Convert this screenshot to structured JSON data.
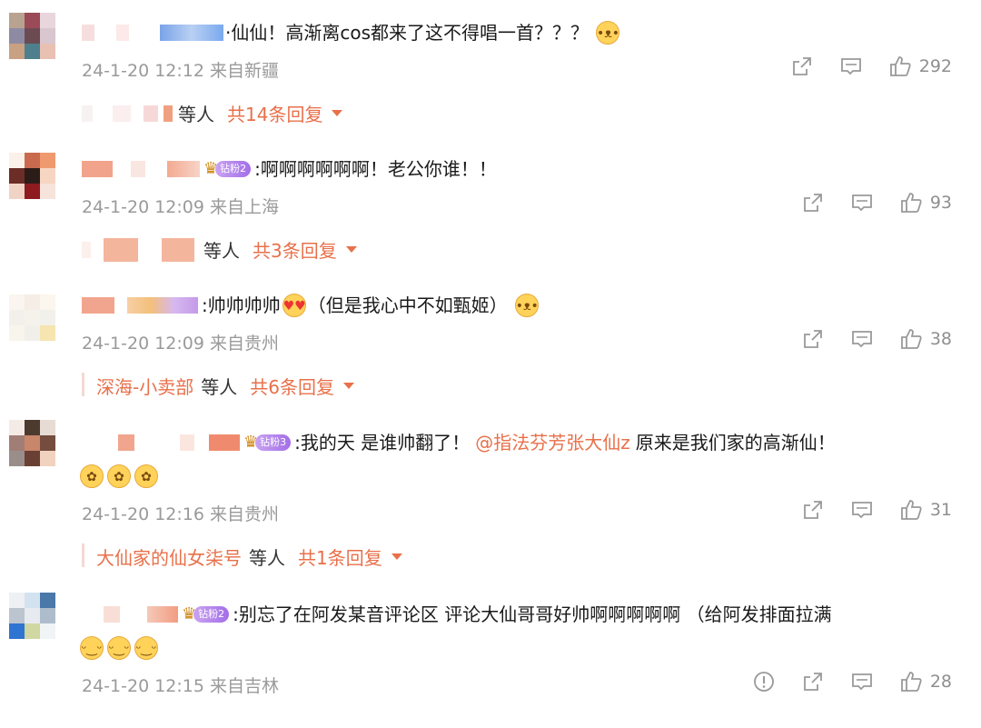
{
  "comments": [
    {
      "text": "·仙仙！高渐离cos都来了这不得唱一首？？？",
      "emoji_after": "dog-face-emoji",
      "time": "24-1-20 12:12",
      "location": "来自新疆",
      "likes": "292",
      "reply_names": "",
      "reply_deng": "等人",
      "reply_total": "共14条回复",
      "badge": null,
      "avatar_colors": [
        "#b8a390",
        "#9a4b57",
        "#e8d6dc",
        "#8f8aa4",
        "#6c4a51",
        "#d9c6cf",
        "#c8a082",
        "#4e7f8d",
        "#e8c1b2"
      ]
    },
    {
      "text": ":啊啊啊啊啊啊！老公你谁！！",
      "time": "24-1-20 12:09",
      "location": "来自上海",
      "likes": "93",
      "reply_names": "",
      "reply_deng": "等人",
      "reply_total": "共3条回复",
      "badge": {
        "fan_label": "钻粉2"
      },
      "avatar_colors": [
        "#fbf1e8",
        "#c96a4e",
        "#ee9a6e",
        "#6b2d25",
        "#2c1c17",
        "#f6d6c3",
        "#f1d3c6",
        "#8d1b1f",
        "#f6e3db"
      ]
    },
    {
      "text": ":帅帅帅帅",
      "text_after": "（但是我心中不如甄姬）",
      "emoji_mid": "heart-eyes-emoji",
      "emoji_after": "dog-face-emoji",
      "time": "24-1-20 12:09",
      "location": "来自贵州",
      "likes": "38",
      "reply_names": "深海-小卖部",
      "reply_deng": "等人",
      "reply_total": "共6条回复",
      "badge": null,
      "avatar_colors": [
        "#faf5ee",
        "#f6ede6",
        "#fbf6ee",
        "#f3f0ec",
        "#f4f2ea",
        "#f1f0ea",
        "#f8f5ec",
        "#f1efe9",
        "#f6e5b0"
      ]
    },
    {
      "text": ":我的天 是谁帅翻了！",
      "mention": "@指法芬芳张大仙z",
      "text_after": "原来是我们家的高渐仙！",
      "emoji_row": [
        "flower-face-emoji",
        "flower-face-emoji",
        "flower-face-emoji"
      ],
      "time": "24-1-20 12:16",
      "location": "来自贵州",
      "likes": "31",
      "reply_names": "大仙家的仙女柒号",
      "reply_deng": "等人",
      "reply_total": "共1条回复",
      "badge": {
        "fan_label": "钻粉3"
      },
      "avatar_colors": [
        "#f5ebe6",
        "#4d3a2f",
        "#e7dcd3",
        "#a07e76",
        "#c8866a",
        "#744d3f",
        "#9a8e8b",
        "#6a4034",
        "#f1d2bf"
      ]
    },
    {
      "text": ":别忘了在阿发某音评论区 评论大仙哥哥好帅啊啊啊啊啊 （给阿发排面拉满",
      "emoji_row": [
        "grin-emoji",
        "grin-emoji",
        "grin-emoji"
      ],
      "time": "24-1-20 12:15",
      "location": "来自吉林",
      "likes": "28",
      "has_report": true,
      "reply_names": "",
      "reply_deng": "",
      "reply_total": "",
      "badge": {
        "fan_label": "钻粉2"
      },
      "avatar_colors": [
        "#eef0f4",
        "#d2e3ef",
        "#4a78a8",
        "#bcc4cf",
        "#e7eaef",
        "#aebdcc",
        "#2f74d0",
        "#d1d7a1",
        "#f1f4f5"
      ]
    }
  ],
  "colors": {
    "accent": "#e8704a",
    "muted": "#9a9a9a"
  }
}
